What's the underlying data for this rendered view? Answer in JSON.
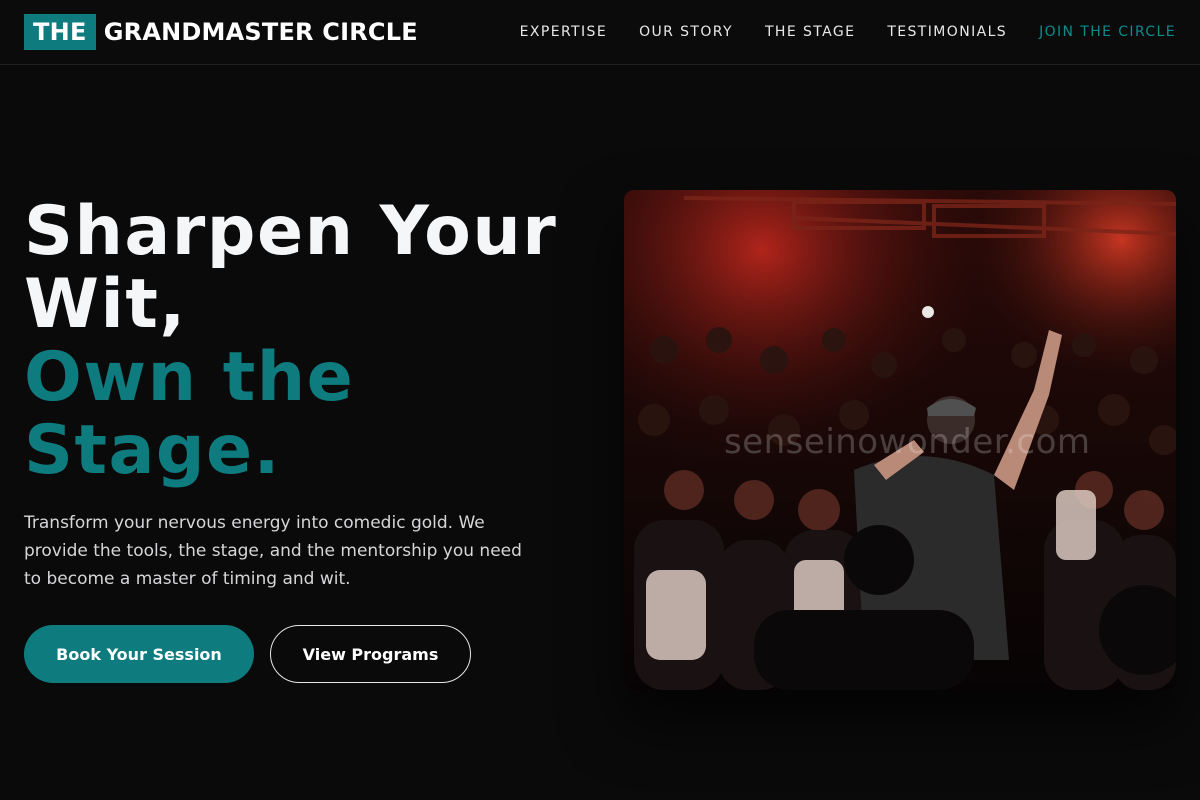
{
  "brand": {
    "mark": "THE",
    "name": "GRANDMASTER CIRCLE"
  },
  "nav": {
    "items": [
      {
        "label": "EXPERTISE"
      },
      {
        "label": "OUR STORY"
      },
      {
        "label": "THE STAGE"
      },
      {
        "label": "TESTIMONIALS"
      },
      {
        "label": "JOIN THE CIRCLE"
      }
    ]
  },
  "hero": {
    "headline_line1": "Sharpen Your",
    "headline_line2": "Wit,",
    "headline_line3": "Own the",
    "headline_line4": "Stage.",
    "lead": "Transform your nervous energy into comedic gold. We provide the tools, the stage, and the mentorship you need to become a master of timing and wit.",
    "primary_cta": "Book Your Session",
    "secondary_cta": "View Programs"
  },
  "photo": {
    "subject": "performer-on-stage-crowd-photo",
    "watermark": "senseinowonder.com"
  },
  "colors": {
    "accent": "#0e7c7e",
    "background": "#0a0a0b",
    "nav_text": "#e8e8e8"
  }
}
